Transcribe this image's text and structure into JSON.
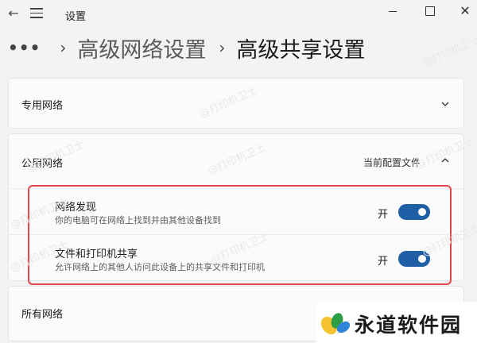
{
  "window": {
    "title": "设置"
  },
  "breadcrumb": {
    "more": "•••",
    "parent": "高级网络设置",
    "current": "高级共享设置"
  },
  "sections": {
    "private": {
      "label": "专用网络"
    },
    "public": {
      "label": "公用网络",
      "status": "当前配置文件",
      "options": [
        {
          "title": "网络发现",
          "desc": "你的电脑可在网络上找到并由其他设备找到",
          "state": "开",
          "on": true
        },
        {
          "title": "文件和打印机共享",
          "desc": "允许网络上的其他人访问此设备上的共享文件和打印机",
          "state": "开",
          "on": true
        }
      ]
    },
    "all": {
      "label": "所有网络"
    }
  },
  "watermark": "@打印机卫士",
  "brand": {
    "name": "永道软件园"
  },
  "colors": {
    "toggle_on": "#1f5fa6",
    "highlight": "#e4474b",
    "background": "#f3f3f3"
  }
}
